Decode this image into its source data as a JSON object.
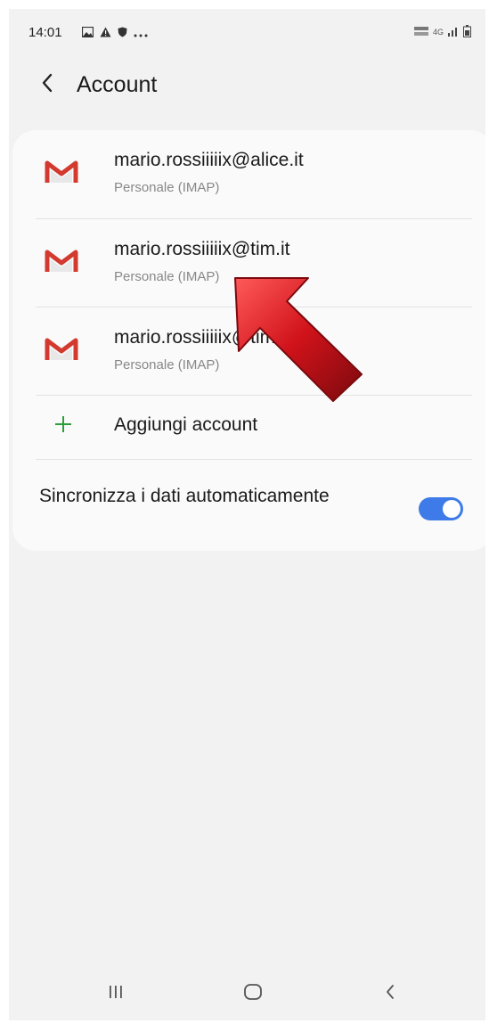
{
  "status_bar": {
    "time": "14:01",
    "left_icons": [
      "gallery-icon",
      "warning-icon",
      "shield-icon",
      "more-dots-icon"
    ],
    "right_network": "4G"
  },
  "header": {
    "title": "Account"
  },
  "accounts": [
    {
      "email": "mario.rossiiiiix@alice.it",
      "type": "Personale (IMAP)"
    },
    {
      "email": "mario.rossiiiiix@tim.it",
      "type": "Personale (IMAP)"
    },
    {
      "email": "mario.rossiiiiix@tim.it",
      "type": "Personale (IMAP)"
    }
  ],
  "add_account": {
    "label": "Aggiungi account"
  },
  "sync": {
    "label": "Sincronizza i dati automaticamente",
    "enabled": true
  },
  "colors": {
    "background": "#f2f2f2",
    "card": "#fafafa",
    "toggle_on": "#3e7be8",
    "add_plus": "#2e9e3a",
    "gmail_red": "#d23a2f",
    "arrow_red": "#c8141c"
  }
}
